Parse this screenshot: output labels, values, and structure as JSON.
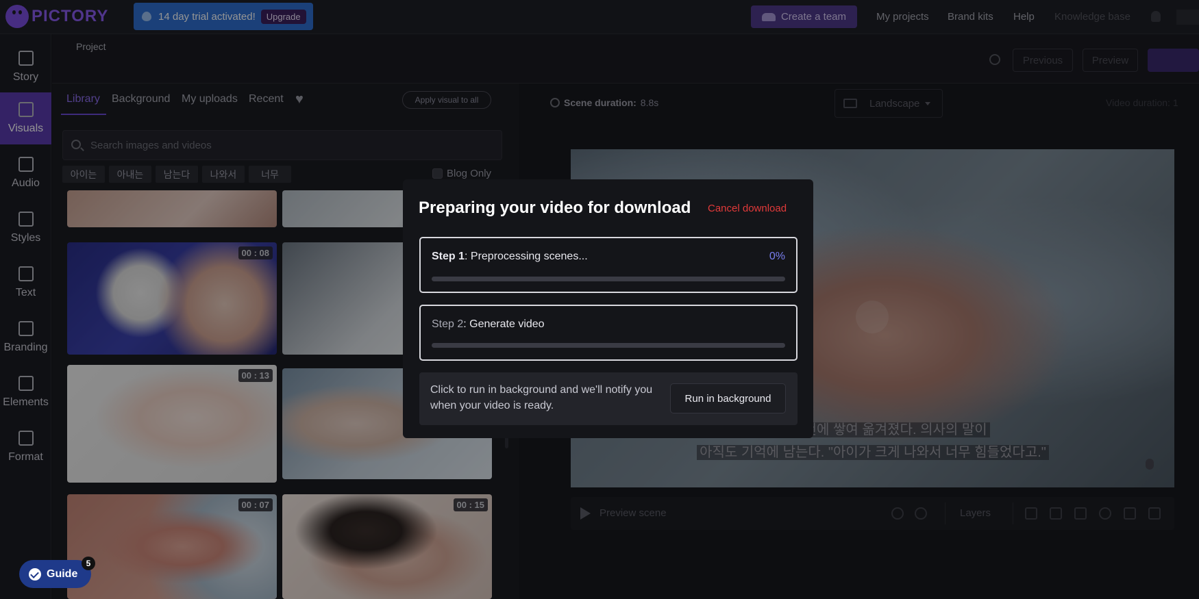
{
  "app": {
    "name": "PICTORY"
  },
  "topbar": {
    "trial_text": "14 day trial activated!",
    "upgrade_label": "Upgrade",
    "create_team_label": "Create a team",
    "nav": [
      "My projects",
      "Brand kits",
      "Help",
      "Knowledge base"
    ]
  },
  "sidebar": {
    "items": [
      {
        "label": "Story",
        "icon": "story-icon"
      },
      {
        "label": "Visuals",
        "icon": "image-icon"
      },
      {
        "label": "Audio",
        "icon": "music-icon"
      },
      {
        "label": "Styles",
        "icon": "brush-icon"
      },
      {
        "label": "Text",
        "icon": "text-icon"
      },
      {
        "label": "Branding",
        "icon": "briefcase-icon"
      },
      {
        "label": "Elements",
        "icon": "shapes-icon"
      },
      {
        "label": "Format",
        "icon": "aspect-ratio-icon"
      }
    ],
    "active": "Visuals"
  },
  "header": {
    "project_label": "Project",
    "buttons": [
      "Previous",
      "Preview"
    ]
  },
  "library": {
    "tabs": [
      "Library",
      "Background",
      "My uploads",
      "Recent"
    ],
    "active_tab": "Library",
    "apply_label": "Apply visual to all",
    "search_placeholder": "Search images and videos",
    "keywords": [
      "아이는",
      "아내는",
      "남는다",
      "나와서",
      "너무"
    ],
    "blog_only_label": "Blog Only",
    "thumbs": [
      {
        "duration": "00 : 08"
      },
      {
        "duration": "00 : 13"
      },
      {
        "duration": "00 : 07"
      },
      {
        "duration": "00 : 15"
      }
    ]
  },
  "editor": {
    "scene_duration_label": "Scene duration:",
    "scene_duration_value": "8.8s",
    "format_label": "Landscape",
    "video_duration_label": "Video duration: 1",
    "caption_line1": "는 하얀 천에 쌓여 옮겨졌다. 의사의 말이",
    "caption_line2": "아직도 기억에 남는다. \"아이가 크게 나와서 너무 힘들었다고.\"",
    "preview_label": "Preview scene",
    "layers_label": "Layers"
  },
  "modal": {
    "title": "Preparing your video for download",
    "cancel_label": "Cancel download",
    "step1_prefix": "Step 1",
    "step1_text": ": Preprocessing scenes...",
    "step1_percent": "0%",
    "step1_progress": 0,
    "step2_prefix": "Step 2",
    "step2_text": ": Generate video",
    "step2_progress": 0,
    "background_text": "Click to run in background and we'll notify you when your video is ready.",
    "run_background_label": "Run in background"
  },
  "guide": {
    "label": "Guide",
    "count": "5"
  },
  "colors": {
    "accent": "#5a3cae",
    "trial": "#2f6fd0",
    "cancel": "#e23a3a",
    "guide": "#1f3a8a"
  }
}
